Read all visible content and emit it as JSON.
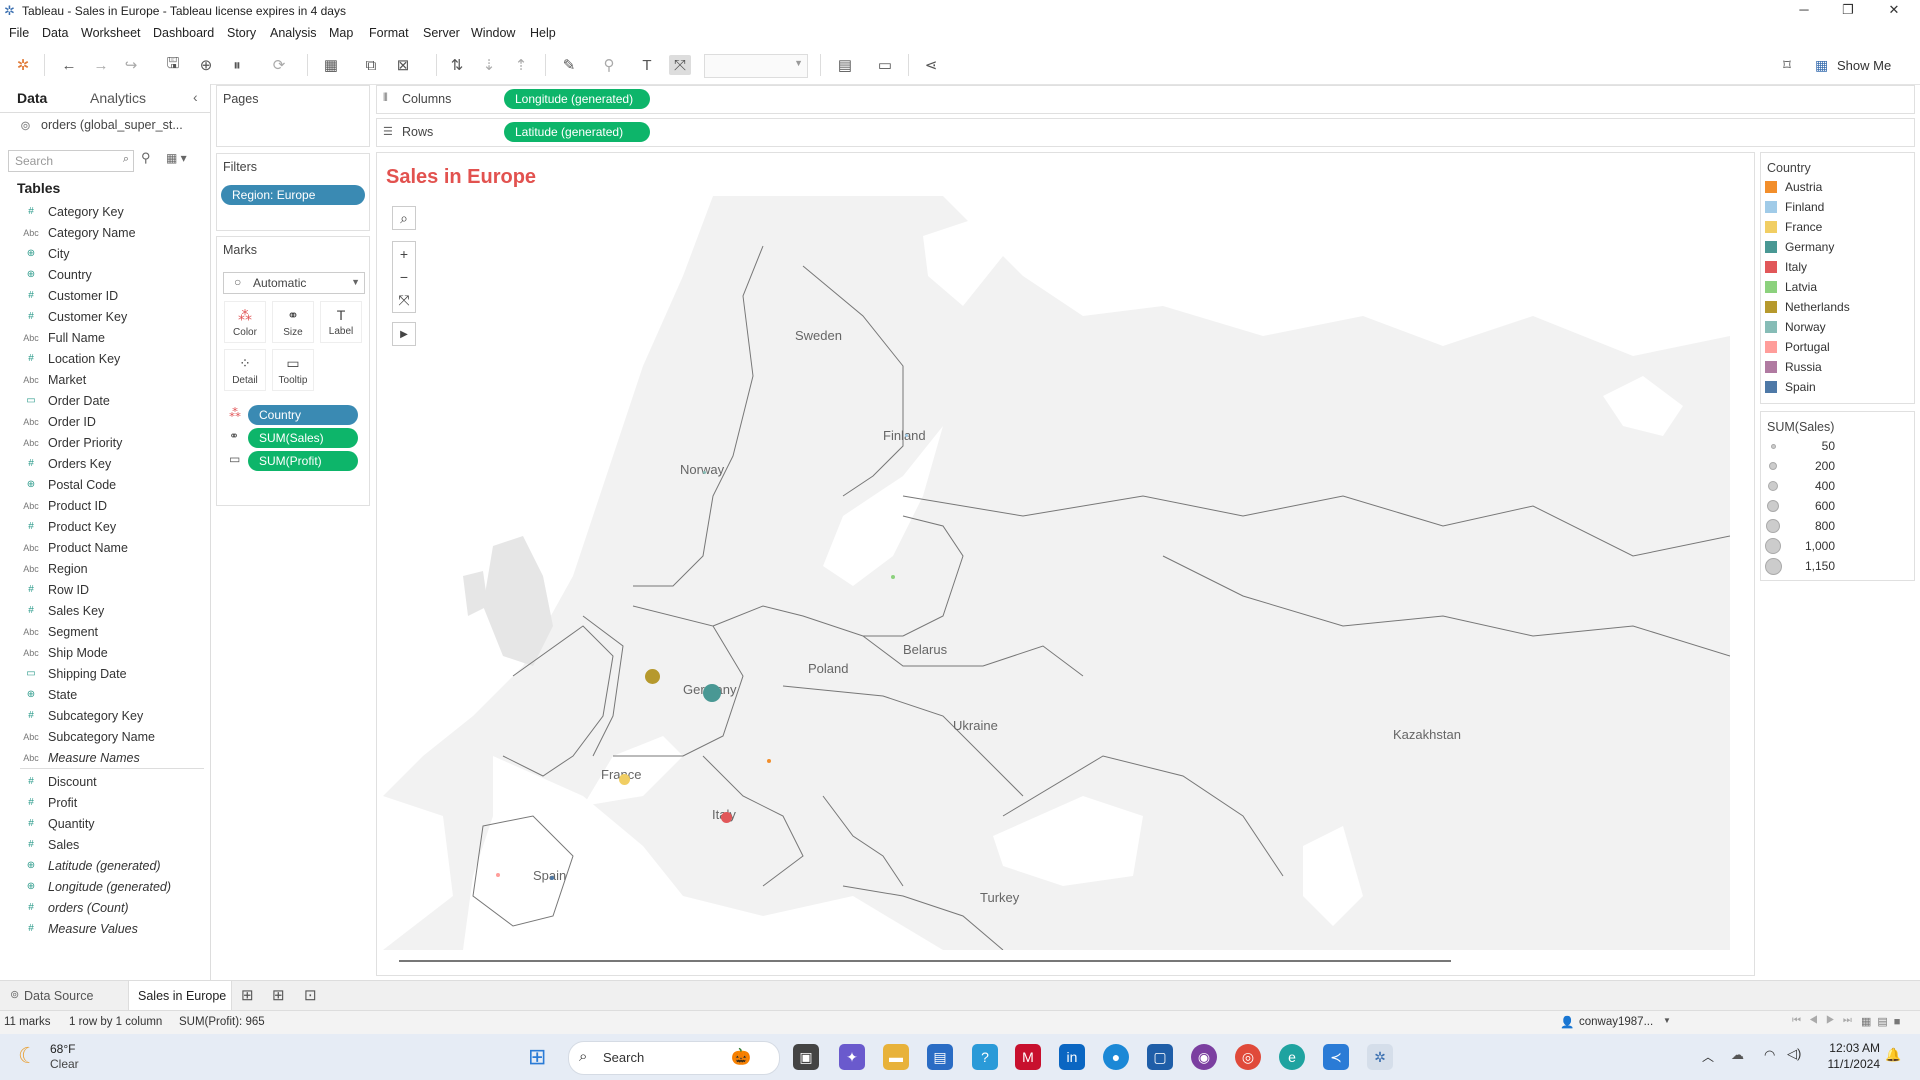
{
  "window": {
    "title": "Tableau - Sales in Europe - Tableau license expires in 4 days",
    "minimize": "─",
    "maximize": "❐",
    "close": "✕"
  },
  "menu": [
    "File",
    "Data",
    "Worksheet",
    "Dashboard",
    "Story",
    "Analysis",
    "Map",
    "Format",
    "Server",
    "Window",
    "Help"
  ],
  "toolbar": {
    "show_me": "Show Me"
  },
  "left_pane": {
    "tabs": {
      "data": "Data",
      "analytics": "Analytics"
    },
    "datasource": "orders (global_super_st...",
    "search_placeholder": "Search",
    "tables_heading": "Tables",
    "dimensions": [
      {
        "icon": "#",
        "label": "Category Key"
      },
      {
        "icon": "Abc",
        "label": "Category Name"
      },
      {
        "icon": "globe",
        "label": "City"
      },
      {
        "icon": "globe",
        "label": "Country"
      },
      {
        "icon": "#",
        "label": "Customer ID"
      },
      {
        "icon": "#",
        "label": "Customer Key"
      },
      {
        "icon": "Abc",
        "label": "Full Name"
      },
      {
        "icon": "#",
        "label": "Location Key"
      },
      {
        "icon": "Abc",
        "label": "Market"
      },
      {
        "icon": "date",
        "label": "Order Date"
      },
      {
        "icon": "Abc",
        "label": "Order ID"
      },
      {
        "icon": "Abc",
        "label": "Order Priority"
      },
      {
        "icon": "#",
        "label": "Orders Key"
      },
      {
        "icon": "globe",
        "label": "Postal Code"
      },
      {
        "icon": "Abc",
        "label": "Product ID"
      },
      {
        "icon": "#",
        "label": "Product Key"
      },
      {
        "icon": "Abc",
        "label": "Product Name"
      },
      {
        "icon": "Abc",
        "label": "Region"
      },
      {
        "icon": "#",
        "label": "Row ID"
      },
      {
        "icon": "#",
        "label": "Sales Key"
      },
      {
        "icon": "Abc",
        "label": "Segment"
      },
      {
        "icon": "Abc",
        "label": "Ship Mode"
      },
      {
        "icon": "date",
        "label": "Shipping Date"
      },
      {
        "icon": "globe",
        "label": "State"
      },
      {
        "icon": "#",
        "label": "Subcategory Key"
      },
      {
        "icon": "Abc",
        "label": "Subcategory Name"
      },
      {
        "icon": "Abc",
        "label": "Measure Names",
        "italic": true
      }
    ],
    "measures": [
      {
        "icon": "#",
        "label": "Discount"
      },
      {
        "icon": "#",
        "label": "Profit"
      },
      {
        "icon": "#",
        "label": "Quantity"
      },
      {
        "icon": "#",
        "label": "Sales"
      },
      {
        "icon": "globe",
        "label": "Latitude (generated)",
        "italic": true
      },
      {
        "icon": "globe",
        "label": "Longitude (generated)",
        "italic": true
      },
      {
        "icon": "#",
        "label": "orders (Count)",
        "italic": true
      },
      {
        "icon": "#",
        "label": "Measure Values",
        "italic": true
      }
    ]
  },
  "shelves": {
    "pages": "Pages",
    "filters": "Filters",
    "filter_pill": "Region: Europe",
    "marks": "Marks",
    "mark_type": "Automatic",
    "mark_buttons": [
      "Color",
      "Size",
      "Label",
      "Detail",
      "Tooltip"
    ],
    "mark_pills": [
      "Country",
      "SUM(Sales)",
      "SUM(Profit)"
    ],
    "columns_label": "Columns",
    "columns_pill": "Longitude (generated)",
    "rows_label": "Rows",
    "rows_pill": "Latitude (generated)"
  },
  "view": {
    "title": "Sales in Europe",
    "map_labels": [
      "Sweden",
      "Finland",
      "Norway",
      "Poland",
      "Belarus",
      "Germany",
      "Ukraine",
      "Kazakhstan",
      "France",
      "Italy",
      "Spain",
      "Turkey"
    ],
    "title_color": "#e2524f"
  },
  "legend_country": {
    "title": "Country",
    "items": [
      {
        "label": "Austria",
        "color": "#f28e2b"
      },
      {
        "label": "Finland",
        "color": "#a0cbe8"
      },
      {
        "label": "France",
        "color": "#f1ce63"
      },
      {
        "label": "Germany",
        "color": "#499894"
      },
      {
        "label": "Italy",
        "color": "#e15759"
      },
      {
        "label": "Latvia",
        "color": "#8cd17d"
      },
      {
        "label": "Netherlands",
        "color": "#b6992d"
      },
      {
        "label": "Norway",
        "color": "#86bcb6"
      },
      {
        "label": "Portugal",
        "color": "#ff9d9a"
      },
      {
        "label": "Russia",
        "color": "#b07aa1"
      },
      {
        "label": "Spain",
        "color": "#4e79a7"
      }
    ]
  },
  "legend_size": {
    "title": "SUM(Sales)",
    "items": [
      "50",
      "200",
      "400",
      "600",
      "800",
      "1,000",
      "1,150"
    ]
  },
  "marks": [
    {
      "country": "Germany",
      "sales": 1150
    },
    {
      "country": "Netherlands",
      "sales": 600
    },
    {
      "country": "France",
      "sales": 300
    },
    {
      "country": "Italy",
      "sales": 350
    },
    {
      "country": "Austria",
      "sales": 60
    },
    {
      "country": "Spain",
      "sales": 50
    },
    {
      "country": "Portugal",
      "sales": 40
    },
    {
      "country": "Latvia",
      "sales": 40
    },
    {
      "country": "Finland",
      "sales": 30
    },
    {
      "country": "Norway",
      "sales": 30
    }
  ],
  "sheet_tabs": {
    "data_source": "Data Source",
    "sheet": "Sales in Europe"
  },
  "status": {
    "marks": "11 marks",
    "rows_cols": "1 row by 1 column",
    "sum_profit": "SUM(Profit): 965",
    "user": "conway1987..."
  },
  "taskbar": {
    "weather_temp": "68°F",
    "weather_desc": "Clear",
    "search": "Search",
    "time": "12:03 AM",
    "date": "11/1/2024"
  }
}
